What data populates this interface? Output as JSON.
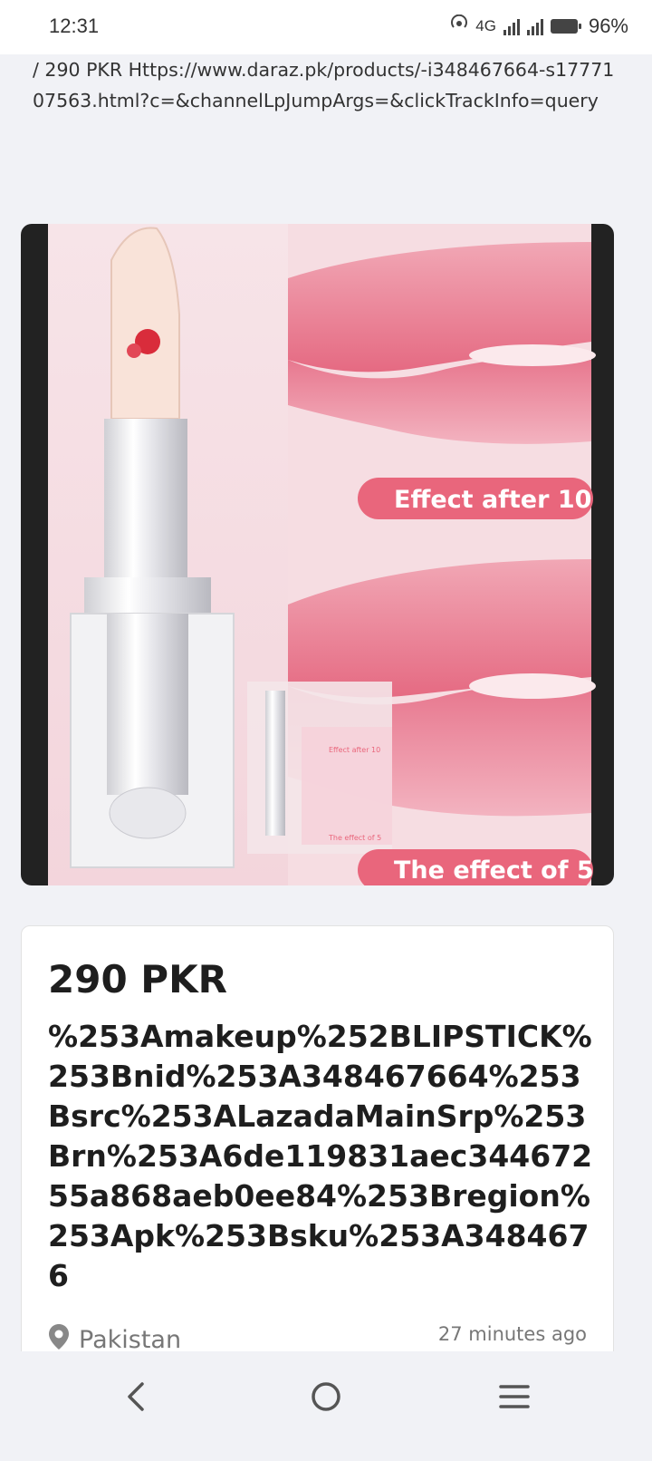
{
  "status_bar": {
    "time": "12:31",
    "network": "4G",
    "battery": "96%"
  },
  "url_text": "/  290 PKR Https://www.daraz.pk/products/-i348467664-s1777107563.html?c=&channelLpJumpArgs=&clickTrackInfo=query",
  "image": {
    "overlay_top": "Effect after 10",
    "overlay_bottom": "The effect of 5",
    "thumb_top": "Effect after 10",
    "thumb_bottom": "The effect of 5"
  },
  "listing": {
    "price": "290 PKR",
    "title": "%253Amakeup%252BLIPSTICK%253Bnid%253A348467664%253Bsrc%253ALazadaMainSrp%253Brn%253A6de119831aec34467255a868aeb0ee84%253Bregion%253Apk%253Bsku%253A3484676",
    "location": "Pakistan",
    "time_ago": "27 minutes ago"
  },
  "nav": {
    "back": "back",
    "home": "home",
    "menu": "menu"
  },
  "colors": {
    "background": "#f1f2f6",
    "lip_pink": "#e96b83",
    "label_pink": "#e9667c"
  }
}
